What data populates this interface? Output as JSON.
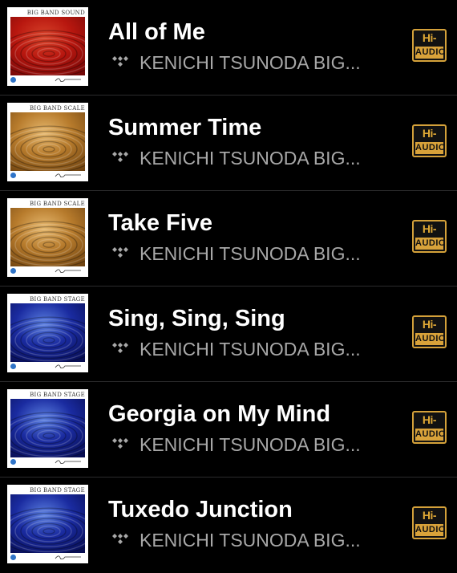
{
  "tracks": [
    {
      "title": "All of Me",
      "artist": "KENICHI TSUNODA BIG...",
      "album_label": "BIG BAND SOUND",
      "art_palette": [
        "#6e0606",
        "#b8170f",
        "#d8432a"
      ],
      "quality_badge": {
        "top": "Hi-Res",
        "bottom": "AUDIO"
      },
      "source_icon": "tidal-icon"
    },
    {
      "title": "Summer Time",
      "artist": "KENICHI TSUNODA BIG...",
      "album_label": "BIG BAND SCALE",
      "art_palette": [
        "#6a3f0e",
        "#b77b2c",
        "#e6b86e"
      ],
      "quality_badge": {
        "top": "Hi-Res",
        "bottom": "AUDIO"
      },
      "source_icon": "tidal-icon"
    },
    {
      "title": "Take Five",
      "artist": "KENICHI TSUNODA BIG...",
      "album_label": "BIG BAND SCALE",
      "art_palette": [
        "#6a3f0e",
        "#b77b2c",
        "#e6b86e"
      ],
      "quality_badge": {
        "top": "Hi-Res",
        "bottom": "AUDIO"
      },
      "source_icon": "tidal-icon"
    },
    {
      "title": "Sing, Sing, Sing",
      "artist": "KENICHI TSUNODA BIG...",
      "album_label": "BIG BAND STAGE",
      "art_palette": [
        "#050a4a",
        "#1a2ba0",
        "#5b7fe0"
      ],
      "quality_badge": {
        "top": "Hi-Res",
        "bottom": "AUDIO"
      },
      "source_icon": "tidal-icon"
    },
    {
      "title": "Georgia on My Mind",
      "artist": "KENICHI TSUNODA BIG...",
      "album_label": "BIG BAND STAGE",
      "art_palette": [
        "#050a4a",
        "#1a2ba0",
        "#5b7fe0"
      ],
      "quality_badge": {
        "top": "Hi-Res",
        "bottom": "AUDIO"
      },
      "source_icon": "tidal-icon"
    },
    {
      "title": "Tuxedo Junction",
      "artist": "KENICHI TSUNODA BIG...",
      "album_label": "BIG BAND STAGE",
      "art_palette": [
        "#050a4a",
        "#1a2ba0",
        "#5b7fe0"
      ],
      "quality_badge": {
        "top": "Hi-Res",
        "bottom": "AUDIO"
      },
      "source_icon": "tidal-icon"
    }
  ],
  "colors": {
    "background": "#000000",
    "title_text": "#ffffff",
    "artist_text": "#a8a8a8",
    "separator": "#2b2b2d",
    "hires_gold": "#d8a23a"
  }
}
